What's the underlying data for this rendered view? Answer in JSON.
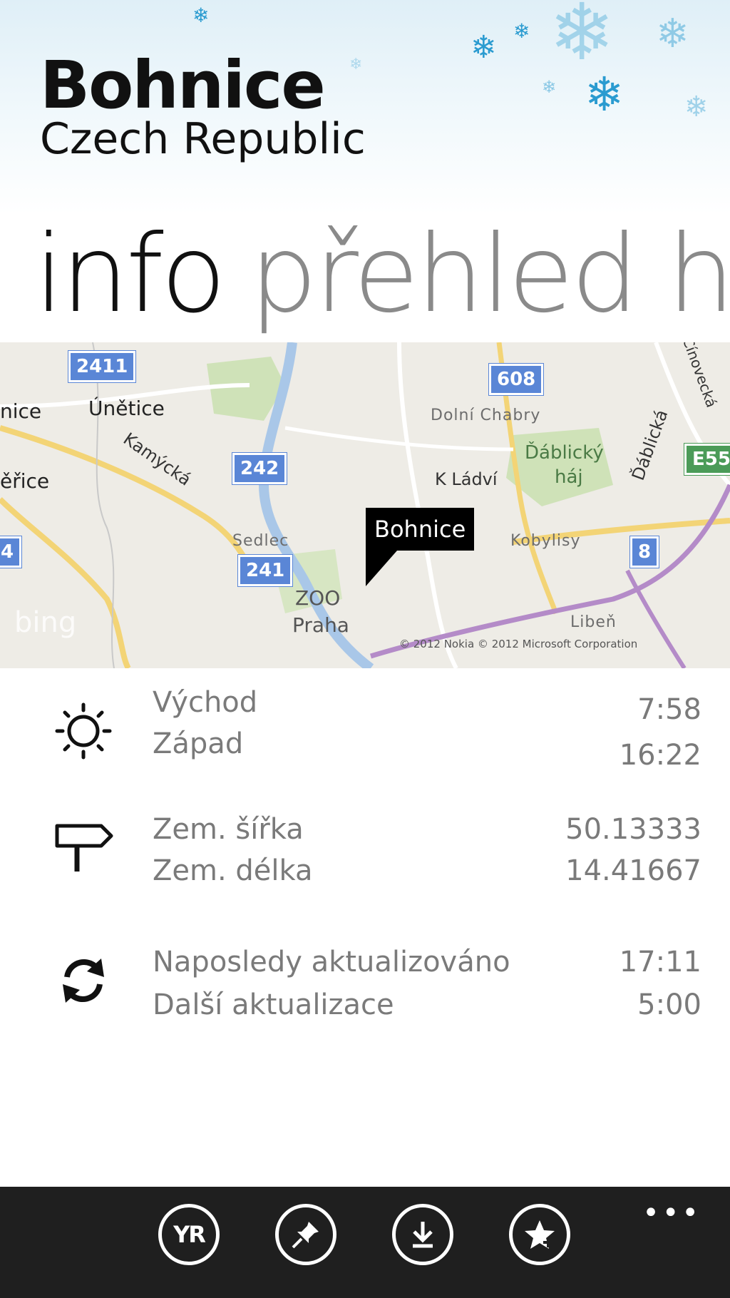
{
  "header": {
    "city": "Bohnice",
    "country": "Czech Republic"
  },
  "pivot": {
    "active": "info",
    "next": "přehled ho"
  },
  "map": {
    "pin_label": "Bohnice",
    "logo": "bing",
    "copyright": "© 2012 Nokia  © 2012 Microsoft Corporation",
    "shields": {
      "s1": "2411",
      "s2": "608",
      "s3": "242",
      "s4": "241",
      "s5": "8",
      "s6": "E55",
      "s7": "4"
    },
    "labels": {
      "unetice": "Únětice",
      "nice": "nice",
      "erice": "ěřice",
      "kamycka": "Kamýcká",
      "dolni_chabry": "Dolní Chabry",
      "ablicky_haj_1": "Ďáblický",
      "ablicky_haj_2": "háj",
      "k_ladvi": "K Ládví",
      "dablicka": "Ďáblická",
      "sedlec": "Sedlec",
      "kobylisy": "Kobylisy",
      "zoo": "ZOO",
      "praha": "Praha",
      "liben": "Libeň",
      "uvozovka": "Cínovecká"
    }
  },
  "info": {
    "sun": {
      "icon": "sun-icon",
      "rise_label": "Východ",
      "rise_value": "7:58",
      "set_label": "Západ",
      "set_value": "16:22"
    },
    "coords": {
      "icon": "signpost-icon",
      "lat_label": "Zem. šířka",
      "lat_value": "50.13333",
      "lon_label": "Zem. délka",
      "lon_value": "14.41667"
    },
    "update": {
      "icon": "refresh-icon",
      "last_label": "Naposledy aktualizováno",
      "last_value": "17:11",
      "next_label": "Další aktualizace",
      "next_value": "5:00"
    }
  },
  "appbar": {
    "buttons": [
      {
        "icon": "yr-logo-icon",
        "text": "YR"
      },
      {
        "icon": "pin-icon"
      },
      {
        "icon": "download-icon"
      },
      {
        "icon": "favorite-star-icon"
      }
    ],
    "more": "•••"
  },
  "colors": {
    "snow": "#2a9bd0",
    "appbar": "#1f1f1f",
    "shield_blue": "#5a86d6",
    "shield_green": "#4b9b58"
  }
}
